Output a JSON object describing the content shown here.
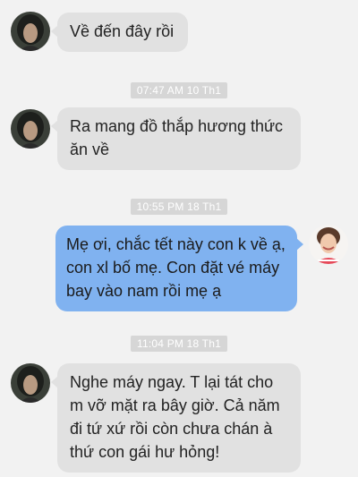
{
  "conversation": {
    "messages": [
      {
        "direction": "incoming",
        "avatar": "mother-avatar",
        "lines": [
          "Về đến đây rồi"
        ]
      },
      {
        "type": "timestamp",
        "text": "07:47 AM 10 Th1"
      },
      {
        "direction": "incoming",
        "avatar": "mother-avatar",
        "lines": [
          "Ra mang đồ thắp hương thức",
          "ăn về"
        ]
      },
      {
        "type": "timestamp",
        "text": "10:55 PM 18 Th1"
      },
      {
        "direction": "outgoing",
        "avatar": "daughter-avatar",
        "lines": [
          "Mẹ ơi, chắc tết này con k về ạ,",
          "con xl bố mẹ. Con đặt vé máy",
          "bay vào nam rồi mẹ ạ"
        ]
      },
      {
        "type": "timestamp",
        "text": "11:04 PM 18 Th1"
      },
      {
        "direction": "incoming",
        "avatar": "mother-avatar",
        "lines": [
          "Nghe máy ngay. T lại tát cho",
          "m vỡ mặt ra bây giờ. Cả năm",
          "đi tứ xứ rồi còn chưa chán à",
          "thứ con gái hư hỏng!"
        ]
      }
    ]
  },
  "colors": {
    "background": "#f2f2f2",
    "incoming_bubble": "#e1e1e1",
    "outgoing_bubble": "#80b2f0",
    "timestamp_badge": "#d6d6d6"
  }
}
